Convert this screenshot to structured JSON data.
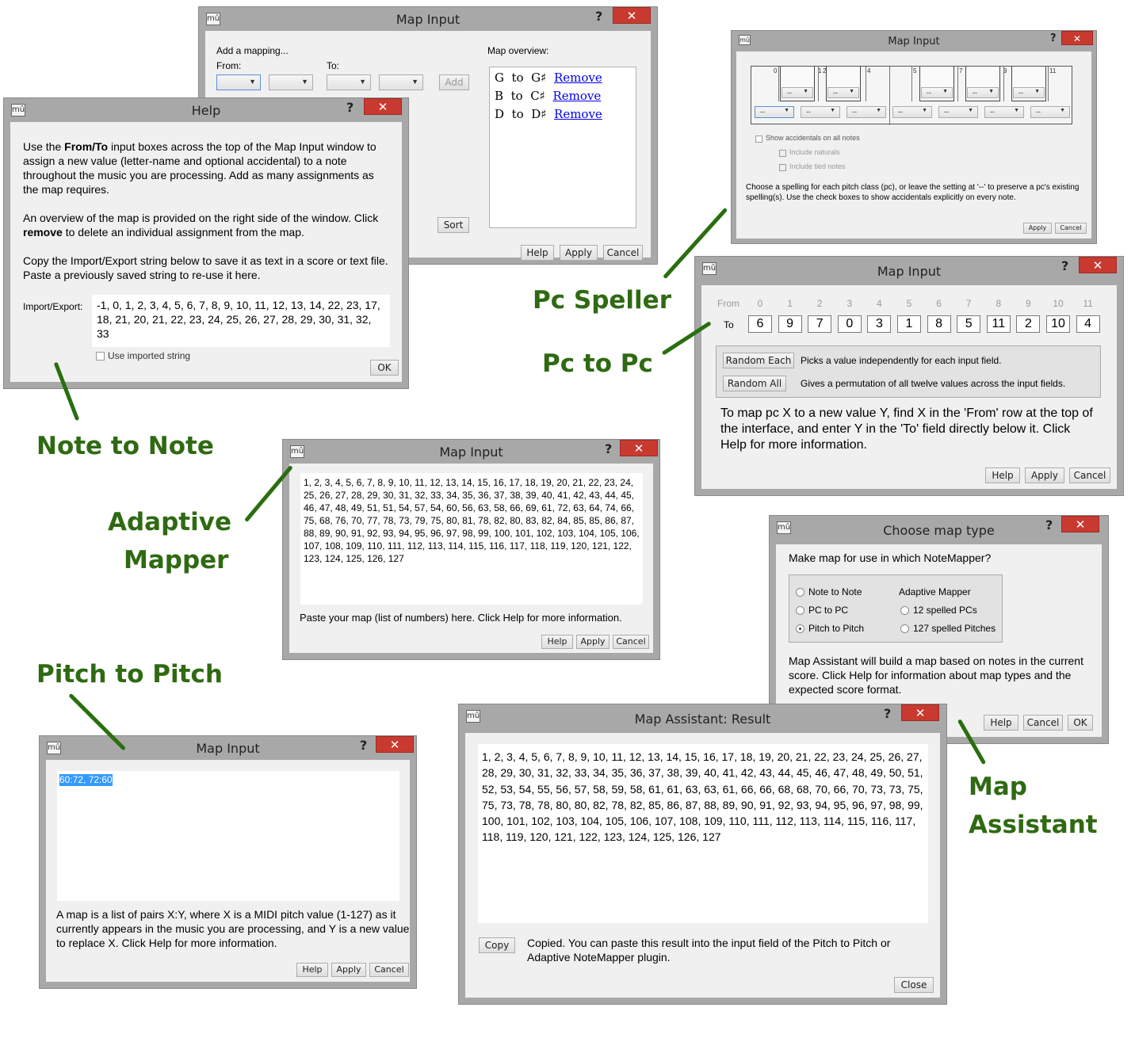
{
  "common": {
    "help_mark": "?",
    "close_mark": "✕",
    "app_logo": "mû"
  },
  "n2n_map": {
    "title": "Map Input",
    "add_heading": "Add a mapping...",
    "from_label": "From:",
    "to_label": "To:",
    "add_button": "Add",
    "overview_heading": "Map overview:",
    "mappings": [
      {
        "from": "G",
        "word": "to",
        "to": "G♯",
        "remove": "Remove"
      },
      {
        "from": "B",
        "word": "to",
        "to": "C♯",
        "remove": "Remove"
      },
      {
        "from": "D",
        "word": "to",
        "to": "D♯",
        "remove": "Remove"
      }
    ],
    "sort_button": "Sort",
    "help_button": "Help",
    "apply_button": "Apply",
    "cancel_button": "Cancel"
  },
  "help_win": {
    "title": "Help",
    "p1_a": "Use the ",
    "p1_bold1": "From",
    "p1_slash": "/",
    "p1_bold2": "To",
    "p1_b": " input boxes across the top of the Map Input window to assign a new value (letter-name and optional accidental) to a note throughout the music you are processing. Add as many assignments as the map requires.",
    "p2_a": "An overview of the map is provided on the right side of the window. Click ",
    "p2_bold": "remove",
    "p2_b": " to delete an individual assignment from the map.",
    "p3": "Copy the Import/Export string below to save it as text in a score or text file. Paste a previously saved string to re-use it here.",
    "import_label": "Import/Export:",
    "import_value": "-1, 0, 1, 2, 3, 4, 5, 6, 7, 8, 9, 10, 11, 12, 13, 14, 22, 23, 17, 18, 21, 20, 21, 22, 23, 24, 25, 26, 27, 28, 29, 30, 31, 32, 33",
    "use_imported_label": "Use imported string",
    "ok_button": "OK"
  },
  "speller": {
    "title": "Map Input",
    "numbers": [
      "0",
      "1",
      "2",
      "3",
      "4",
      "5",
      "6",
      "7",
      "8",
      "9",
      "10",
      "11"
    ],
    "dropdown_value": "--",
    "show_accidentals": "Show accidentals on all notes",
    "include_naturals": "Include naturals",
    "include_tied": "Include tied notes",
    "description": "Choose a spelling for each pitch class (pc), or leave the setting at '--' to preserve a pc's existing spelling(s). Use the check boxes to show accidentals explicitly on every note.",
    "apply_button": "Apply",
    "cancel_button": "Cancel"
  },
  "pc2pc": {
    "title": "Map Input",
    "from_label": "From",
    "to_label": "To",
    "from_values": [
      "0",
      "1",
      "2",
      "3",
      "4",
      "5",
      "6",
      "7",
      "8",
      "9",
      "10",
      "11"
    ],
    "to_values": [
      "6",
      "9",
      "7",
      "0",
      "3",
      "1",
      "8",
      "5",
      "11",
      "2",
      "10",
      "4"
    ],
    "random_each_button": "Random Each",
    "random_each_desc": "Picks a value independently for each input field.",
    "random_all_button": "Random All",
    "random_all_desc": "Gives a permutation of all twelve values across the input fields.",
    "description": "To map pc X to a new value Y, find X in the 'From' row at the top of the interface, and enter Y in the 'To' field directly below it. Click Help for more information.",
    "help_button": "Help",
    "apply_button": "Apply",
    "cancel_button": "Cancel"
  },
  "adaptive": {
    "title": "Map Input",
    "map_text": "1, 2, 3, 4, 5, 6, 7, 8, 9, 10, 11, 12, 13, 14, 15, 16, 17, 18, 19, 20, 21, 22, 23, 24, 25, 26, 27, 28, 29, 30, 31, 32, 33, 34, 35, 36, 37, 38, 39, 40, 41, 42, 43, 44, 45, 46, 47, 48, 49, 51, 51, 54, 57, 54, 60, 56, 63, 58, 66, 69, 61, 72, 63, 64, 74, 66, 75, 68, 76, 70, 77, 78, 73, 79, 75, 80, 81, 78, 82, 80, 83, 82, 84, 85, 85, 86, 87, 88, 89, 90, 91, 92, 93, 94, 95, 96, 97, 98, 99, 100, 101, 102, 103, 104, 105, 106, 107, 108, 109, 110, 111, 112, 113, 114, 115, 116, 117, 118, 119, 120, 121, 122, 123, 124, 125, 126, 127",
    "hint": "Paste your map (list of numbers) here. Click Help for more information.",
    "help_button": "Help",
    "apply_button": "Apply",
    "cancel_button": "Cancel"
  },
  "choose": {
    "title": "Choose map type",
    "question": "Make map for use in which NoteMapper?",
    "opt_note_to_note": "Note to Note",
    "opt_pc_to_pc": "PC to PC",
    "opt_pitch_to_pitch": "Pitch to Pitch",
    "adaptive_heading": "Adaptive Mapper",
    "opt_12_spelled": "12 spelled PCs",
    "opt_127_spelled": "127 spelled Pitches",
    "description": "Map Assistant will build a map based on notes in the current score. Click Help for information about map types and the expected score format.",
    "help_button": "Help",
    "cancel_button": "Cancel",
    "ok_button": "OK"
  },
  "result": {
    "title": "Map Assistant: Result",
    "map_text": "1, 2, 3, 4, 5, 6, 7, 8, 9, 10, 11, 12, 13, 14, 15, 16, 17, 18, 19, 20, 21, 22, 23, 24, 25, 26, 27, 28, 29, 30, 31, 32, 33, 34, 35, 36, 37, 38, 39, 40, 41, 42, 43, 44, 45, 46, 47, 48, 49, 50, 51, 52, 53, 54, 55, 56, 57, 58, 59, 58, 61, 61, 63, 63, 61, 66, 66, 68, 68, 70, 66, 70, 73, 73, 75, 75, 73, 78, 78, 80, 80, 82, 78, 82, 85, 86, 87, 88, 89, 90, 91, 92, 93, 94, 95, 96, 97, 98, 99, 100, 101, 102, 103, 104, 105, 106, 107, 108, 109, 110, 111, 112, 113, 114, 115, 116, 117, 118, 119, 120, 121, 122, 123, 124, 125, 126, 127",
    "copy_button": "Copy",
    "copied_text": "Copied. You can paste this result into the input field of the Pitch to Pitch or Adaptive NoteMapper plugin.",
    "close_button": "Close"
  },
  "pitch": {
    "title": "Map Input",
    "map_text": "60:72, 72:60",
    "description": "A map is a list of pairs X:Y, where X is a MIDI pitch value (1-127) as it currently appears in the music you are processing, and Y is a new value to replace X. Click Help for more information.",
    "help_button": "Help",
    "apply_button": "Apply",
    "cancel_button": "Cancel"
  },
  "labels": {
    "pc_speller": "Pc Speller",
    "pc_to_pc": "Pc to Pc",
    "note_to_note": "Note to Note",
    "adaptive_line1": "Adaptive",
    "adaptive_line2": "Mapper",
    "pitch_to_pitch": "Pitch to Pitch",
    "map_line1": "Map",
    "map_line2": "Assistant"
  },
  "colors": {
    "label_green": "#2f6a12",
    "close_red": "#c83a30",
    "selection_blue": "#3399ff"
  }
}
